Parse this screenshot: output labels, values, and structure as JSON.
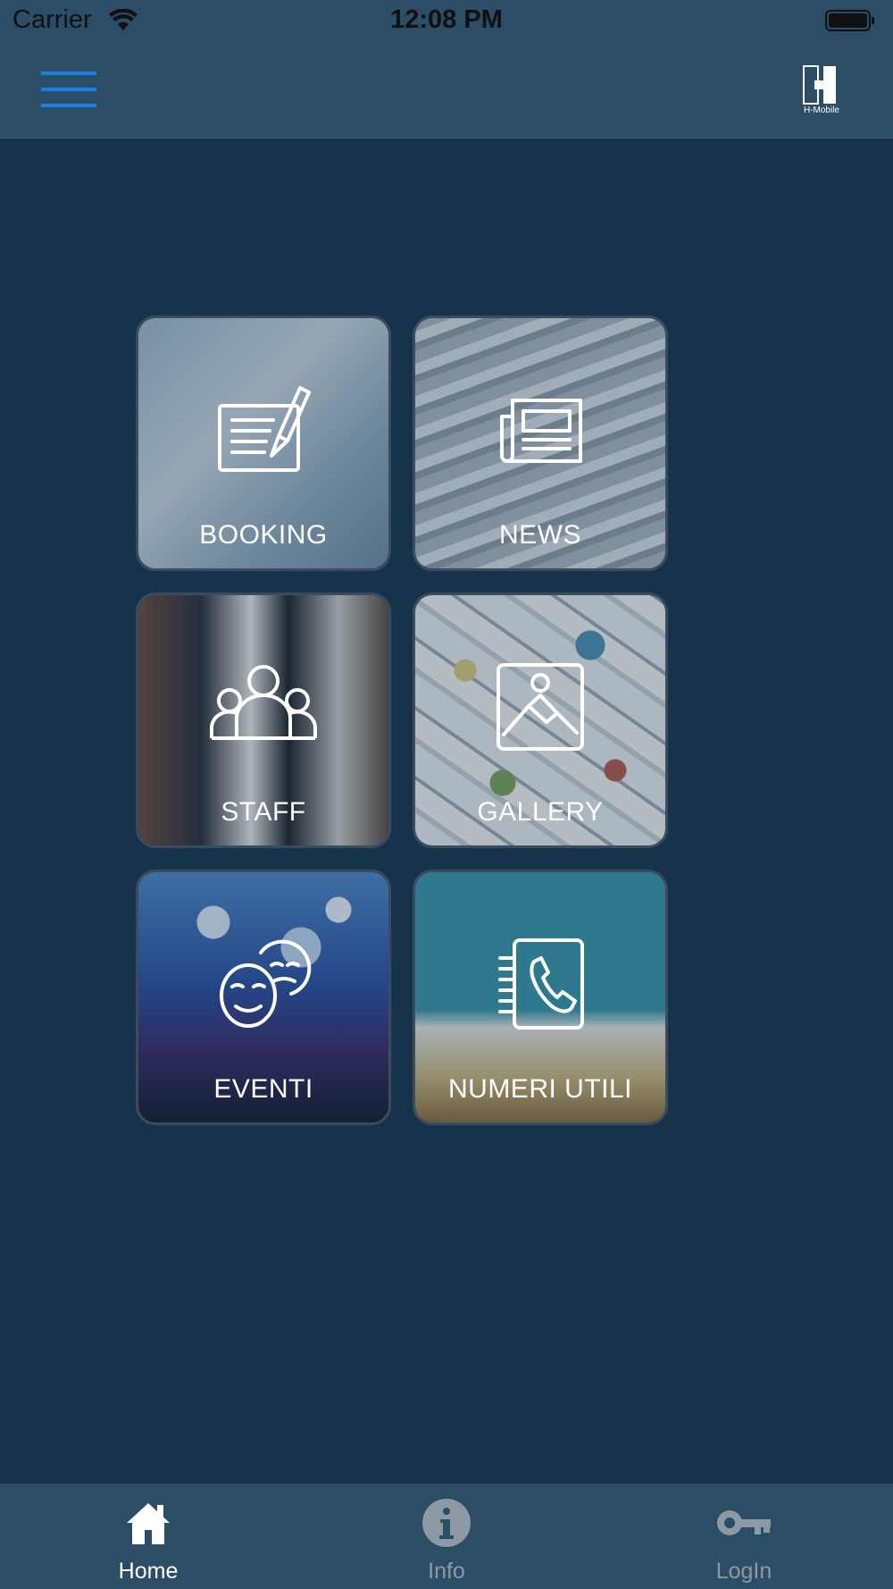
{
  "status_bar": {
    "carrier": "Carrier",
    "time": "12:08 PM"
  },
  "header": {
    "logo_text": "H-Mobile",
    "logo_mark": "MOBILE H"
  },
  "tiles": [
    {
      "label": "BOOKING",
      "icon": "booking-form-icon"
    },
    {
      "label": "NEWS",
      "icon": "newspaper-icon"
    },
    {
      "label": "STAFF",
      "icon": "group-people-icon"
    },
    {
      "label": "GALLERY",
      "icon": "image-photo-icon"
    },
    {
      "label": "EVENTI",
      "icon": "theater-masks-icon"
    },
    {
      "label": "NUMERI UTILI",
      "icon": "phone-book-icon"
    }
  ],
  "tab_bar": {
    "items": [
      {
        "label": "Home",
        "icon": "home-icon",
        "active": true
      },
      {
        "label": "Info",
        "icon": "info-icon",
        "active": false
      },
      {
        "label": "LogIn",
        "icon": "key-icon",
        "active": false
      }
    ]
  },
  "colors": {
    "background": "#17334b",
    "bar": "#2b4d66",
    "accent": "#1a7fe5",
    "tab_active": "#ffffff",
    "tab_inactive": "#8d99a3"
  }
}
